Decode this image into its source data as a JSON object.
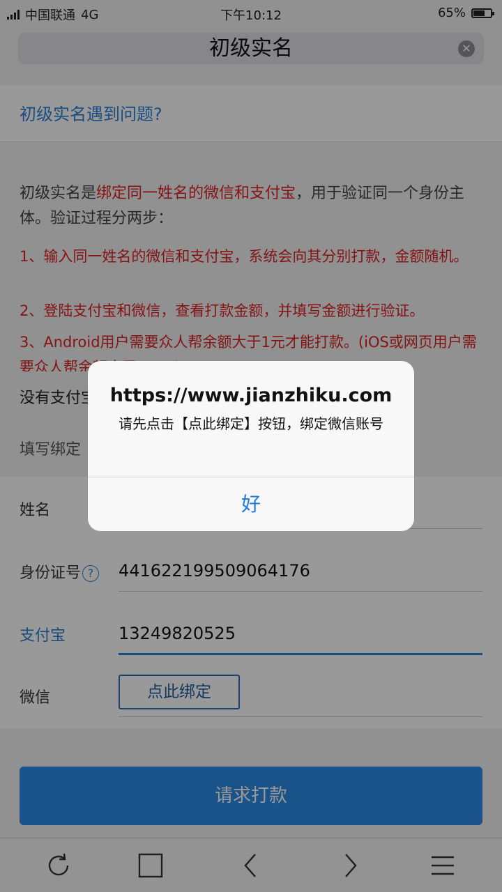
{
  "status_bar": {
    "carrier": "中国联通",
    "network": "4G",
    "time": "下午10:12",
    "battery": "65%",
    "battery_level": 0.65
  },
  "address_bar": {
    "title": "初级实名"
  },
  "help": {
    "link": "初级实名遇到问题?"
  },
  "intro": {
    "prefix": "初级实名是",
    "highlight": "绑定同一姓名的微信和支付宝",
    "suffix": "，用于验证同一个身份主体。验证过程分两步："
  },
  "steps": [
    "1、输入同一姓名的微信和支付宝，系统会向其分别打款，金额随机。",
    "2、登陆支付宝和微信，查看打款金额，并填写金额进行验证。",
    "3、Android用户需要众人帮余额大于1元才能打款。(iOS或网页用户需要众人帮余额大于1.0元)"
  ],
  "no_alipay": "没有支付宝",
  "fill_label": "填写绑定",
  "form": {
    "name_label": "姓名",
    "id_label": "身份证号",
    "id_help": "?",
    "id_value": "441622199509064176",
    "alipay_label": "支付宝",
    "alipay_value": "13249820525",
    "wechat_label": "微信",
    "bind_button": "点此绑定"
  },
  "submit": "请求打款",
  "bottom_nav": [
    "refresh-icon",
    "tabs-icon",
    "back-icon",
    "forward-icon",
    "menu-icon"
  ],
  "alert": {
    "title": "https://www.jianzhiku.com",
    "message": "请先点击【点此绑定】按钮，绑定微信账号",
    "ok": "好"
  }
}
